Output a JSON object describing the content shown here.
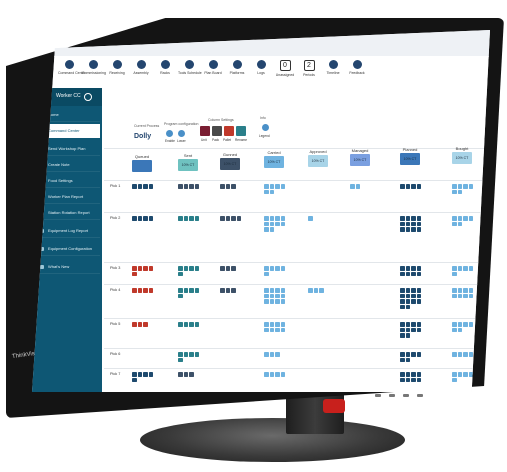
{
  "window": {
    "title": "Diamond Retail CC"
  },
  "menu": [
    "File",
    "Settings",
    "Help"
  ],
  "toolbar": {
    "buttons": [
      "Command Center",
      "Commissioning",
      "Receiving",
      "Assembly",
      "Racks",
      "Tools Schedule",
      "Plan Board",
      "Platforms",
      "Logs",
      "Unassigned",
      "Periods",
      "Timeline",
      "Feedback"
    ],
    "counters": [
      "0",
      "2"
    ]
  },
  "sidebar": {
    "header": "Worker CC",
    "items": [
      "Home",
      "Command Center",
      "Send Workshop Plan",
      "Create Note",
      "Food Settings",
      "Worker Plan Report",
      "Station Rotation Report",
      "Equipment Log Report",
      "Equipment Configuration",
      "What's New"
    ]
  },
  "panel": {
    "current_process_label": "Current Process",
    "current_process_value": "Dolly",
    "program_config_label": "Program configuration",
    "program_config_items": [
      "Enable",
      "Lower"
    ],
    "column_settings_label": "Column Settings",
    "column_settings_items": [
      "Unit",
      "Pack",
      "Pallet",
      "Rename"
    ],
    "info_label": "Info",
    "info_item": "Legend"
  },
  "grid": {
    "columns": [
      {
        "name": "Queued",
        "badge": ""
      },
      {
        "name": "Sent",
        "badge": "10% CT"
      },
      {
        "name": "Gunned",
        "badge": "10% CT"
      },
      {
        "name": "Carried",
        "badge": "10% CT"
      },
      {
        "name": "Approved",
        "badge": "10% CT"
      },
      {
        "name": "Managed",
        "badge": "10% CT"
      },
      {
        "name": "Planned",
        "badge": "10% CT"
      },
      {
        "name": "Bought",
        "badge": "10% CT"
      }
    ],
    "rows": [
      "Pick 1",
      "Pick 2",
      "Pick 3",
      "Pick 4",
      "Pick 5",
      "Pick 6",
      "Pick 7"
    ]
  },
  "bezel": {
    "brand": "ThinkVision"
  },
  "colors": {
    "sidebar": "#0e5774",
    "dark_cell": "#1e4a6e",
    "teal_cell": "#2a7f8a",
    "light_cell": "#6fb3e0",
    "red_cell": "#c0392b",
    "gray_cell": "#3d5168",
    "accent_swatch": "#7a1e32"
  }
}
